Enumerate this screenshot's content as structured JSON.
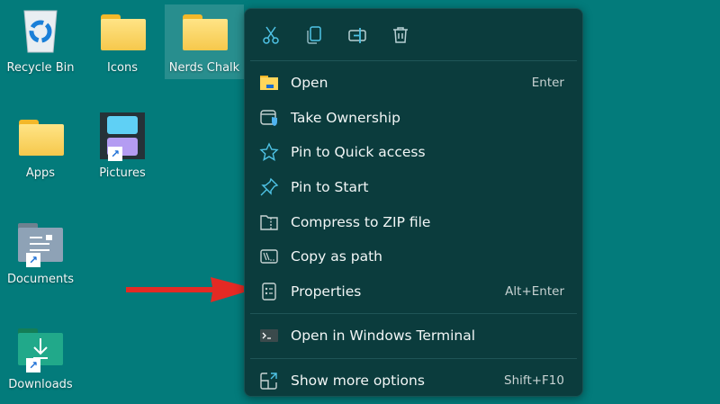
{
  "desktop": {
    "icons": [
      {
        "label": "Recycle Bin",
        "icon": "recycle-bin-icon"
      },
      {
        "label": "Icons",
        "icon": "folder-icon"
      },
      {
        "label": "Nerds Chalk",
        "icon": "folder-icon",
        "selected": true
      },
      {
        "label": "Apps",
        "icon": "folder-icon"
      },
      {
        "label": "Pictures",
        "icon": "pictures-icon",
        "shortcut": true
      },
      {
        "label": "Documents",
        "icon": "documents-icon",
        "shortcut": true
      },
      {
        "label": "Downloads",
        "icon": "downloads-icon",
        "shortcut": true
      }
    ]
  },
  "context_menu": {
    "toolbar": [
      "cut-icon",
      "copy-icon",
      "rename-icon",
      "delete-icon"
    ],
    "items": [
      {
        "label": "Open",
        "shortcut": "Enter",
        "icon": "folder-open-icon"
      },
      {
        "label": "Take Ownership",
        "icon": "take-ownership-icon"
      },
      {
        "label": "Pin to Quick access",
        "icon": "star-icon"
      },
      {
        "label": "Pin to Start",
        "icon": "pin-icon"
      },
      {
        "label": "Compress to ZIP file",
        "icon": "zip-icon"
      },
      {
        "label": "Copy as path",
        "icon": "copy-path-icon"
      },
      {
        "label": "Properties",
        "shortcut": "Alt+Enter",
        "icon": "properties-icon"
      },
      {
        "label": "Open in Windows Terminal",
        "icon": "terminal-icon"
      },
      {
        "label": "Show more options",
        "shortcut": "Shift+F10",
        "icon": "show-more-icon"
      }
    ]
  },
  "annotation": {
    "arrow_color": "#e42a24"
  },
  "colors": {
    "desktop": "#037b7b",
    "menu": "#0b3c3d",
    "accent": "#4fc3e6"
  }
}
